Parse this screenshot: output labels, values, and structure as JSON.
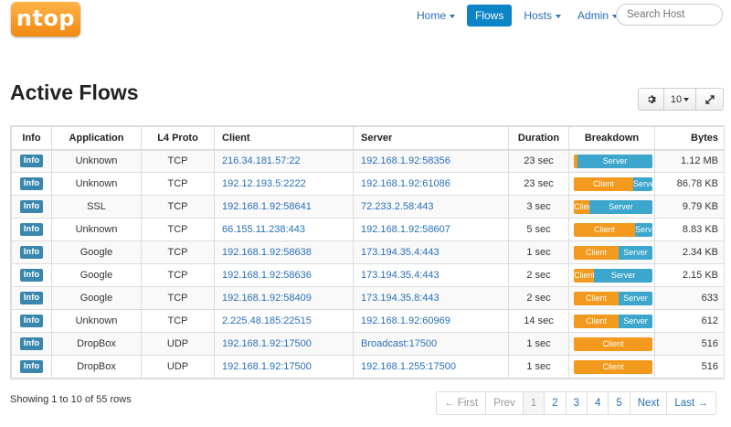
{
  "app": {
    "logo": "ntop"
  },
  "nav": {
    "items": [
      {
        "label": "Home",
        "dropdown": true,
        "active": false
      },
      {
        "label": "Flows",
        "dropdown": false,
        "active": true
      },
      {
        "label": "Hosts",
        "dropdown": true,
        "active": false
      },
      {
        "label": "Admin",
        "dropdown": true,
        "active": false
      }
    ],
    "search_placeholder": "Search Host"
  },
  "page": {
    "title": "Active Flows"
  },
  "toolbar": {
    "settings_icon": "gear-icon",
    "rows_label": "10",
    "expand_icon": "expand-icon"
  },
  "table": {
    "headers": [
      "Info",
      "Application",
      "L4 Proto",
      "Client",
      "Server",
      "Duration",
      "Breakdown",
      "Bytes"
    ],
    "rows": [
      {
        "info": "Info",
        "app": "Unknown",
        "proto": "TCP",
        "client": "216.34.181.57:22",
        "server": "192.168.1.92:58356",
        "duration": "23 sec",
        "client_pct": 0.05,
        "client_label": "",
        "server_label": "Server",
        "bytes": "1.12 MB"
      },
      {
        "info": "Info",
        "app": "Unknown",
        "proto": "TCP",
        "client": "192.12.193.5:2222",
        "server": "192.168.1.92:61086",
        "duration": "23 sec",
        "client_pct": 0.75,
        "client_label": "Client",
        "server_label": "Server",
        "bytes": "86.78 KB"
      },
      {
        "info": "Info",
        "app": "SSL",
        "proto": "TCP",
        "client": "192.168.1.92:58641",
        "server": "72.233.2.58:443",
        "duration": "3 sec",
        "client_pct": 0.2,
        "client_label": "Client",
        "server_label": "Server",
        "bytes": "9.79 KB"
      },
      {
        "info": "Info",
        "app": "Unknown",
        "proto": "TCP",
        "client": "66.155.11.238:443",
        "server": "192.168.1.92:58607",
        "duration": "5 sec",
        "client_pct": 0.78,
        "client_label": "Client",
        "server_label": "Server",
        "bytes": "8.83 KB"
      },
      {
        "info": "Info",
        "app": "Google",
        "proto": "TCP",
        "client": "192.168.1.92:58638",
        "server": "173.194.35.4:443",
        "duration": "1 sec",
        "client_pct": 0.57,
        "client_label": "Client",
        "server_label": "Server",
        "bytes": "2.34 KB"
      },
      {
        "info": "Info",
        "app": "Google",
        "proto": "TCP",
        "client": "192.168.1.92:58636",
        "server": "173.194.35.4:443",
        "duration": "2 sec",
        "client_pct": 0.26,
        "client_label": "Client",
        "server_label": "Server",
        "bytes": "2.15 KB"
      },
      {
        "info": "Info",
        "app": "Google",
        "proto": "TCP",
        "client": "192.168.1.92:58409",
        "server": "173.194.35.8:443",
        "duration": "2 sec",
        "client_pct": 0.57,
        "client_label": "Client",
        "server_label": "Server",
        "bytes": "633"
      },
      {
        "info": "Info",
        "app": "Unknown",
        "proto": "TCP",
        "client": "2.225.48.185:22515",
        "server": "192.168.1.92:60969",
        "duration": "14 sec",
        "client_pct": 0.57,
        "client_label": "Client",
        "server_label": "Server",
        "bytes": "612"
      },
      {
        "info": "Info",
        "app": "DropBox",
        "proto": "UDP",
        "client": "192.168.1.92:17500",
        "server": "Broadcast:17500",
        "duration": "1 sec",
        "client_pct": 1.0,
        "client_label": "Client",
        "server_label": "",
        "bytes": "516"
      },
      {
        "info": "Info",
        "app": "DropBox",
        "proto": "UDP",
        "client": "192.168.1.92:17500",
        "server": "192.168.1.255:17500",
        "duration": "1 sec",
        "client_pct": 1.0,
        "client_label": "Client",
        "server_label": "",
        "bytes": "516"
      }
    ]
  },
  "footer": {
    "summary": "Showing 1 to 10 of 55 rows",
    "pagination": [
      {
        "label": "← First",
        "state": "disabled"
      },
      {
        "label": "Prev",
        "state": "disabled"
      },
      {
        "label": "1",
        "state": "current"
      },
      {
        "label": "2",
        "state": "link"
      },
      {
        "label": "3",
        "state": "link"
      },
      {
        "label": "4",
        "state": "link"
      },
      {
        "label": "5",
        "state": "link"
      },
      {
        "label": "Next",
        "state": "link"
      },
      {
        "label": "Last →",
        "state": "link"
      }
    ]
  },
  "colors": {
    "accent": "#0b84c8",
    "link": "#2a6fb7",
    "client_bar": "#f39a1e",
    "server_bar": "#3ca6cc",
    "info_badge": "#3a87ad",
    "logo": "#f08a12"
  }
}
